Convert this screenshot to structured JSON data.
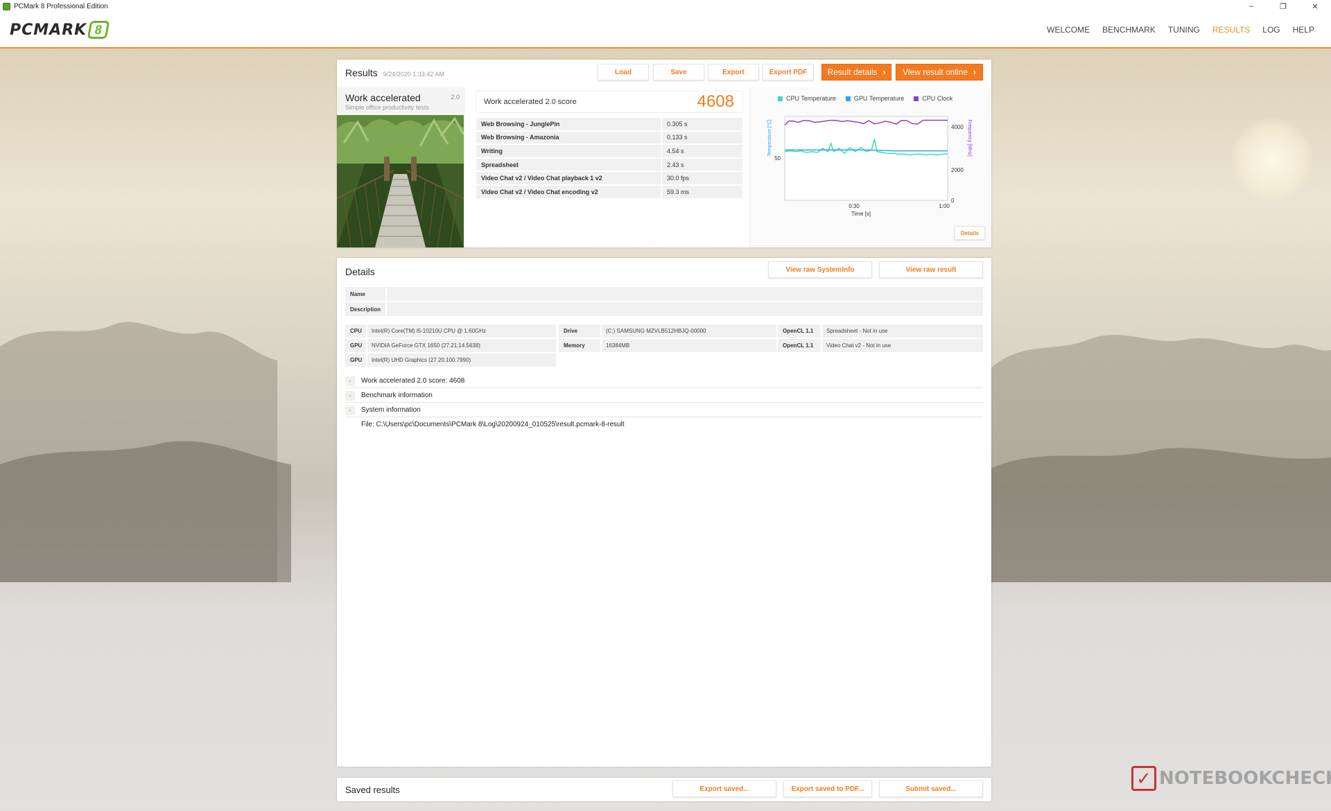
{
  "window": {
    "title": "PCMark 8 Professional Edition",
    "minimize": "–",
    "maximize": "❐",
    "close": "✕"
  },
  "header": {
    "logo_text": "PCMARK",
    "logo_badge": "8",
    "nav": [
      "WELCOME",
      "BENCHMARK",
      "TUNING",
      "RESULTS",
      "LOG",
      "HELP"
    ],
    "active_nav": "RESULTS"
  },
  "results": {
    "title": "Results",
    "date": "9/24/2020 1:33:42 AM",
    "buttons": {
      "load": "Load",
      "save": "Save",
      "export": "Export",
      "export_pdf": "Export PDF",
      "result_details": "Result details",
      "view_online": "View result online",
      "chevron": "›"
    },
    "test": {
      "name": "Work accelerated",
      "version": "2.0",
      "subtitle": "Simple office productivity tests"
    },
    "score_label": "Work accelerated 2.0 score",
    "score_value": "4608",
    "subtests": [
      {
        "name": "Web Browsing - JunglePin",
        "value": "0.305 s"
      },
      {
        "name": "Web Browsing - Amazonia",
        "value": "0.133 s"
      },
      {
        "name": "Writing",
        "value": "4.54 s"
      },
      {
        "name": "Spreadsheet",
        "value": "2.43 s"
      },
      {
        "name": "Video Chat v2 / Video Chat playback 1 v2",
        "value": "30.0 fps"
      },
      {
        "name": "Video Chat v2 / Video Chat encoding v2",
        "value": "59.3 ms"
      }
    ],
    "chart_details_button": "Details"
  },
  "chart_data": {
    "type": "line",
    "legend": [
      {
        "name": "CPU Temperature",
        "color": "#3ddbb5"
      },
      {
        "name": "GPU Temperature",
        "color": "#29a9e8"
      },
      {
        "name": "CPU Clock",
        "color": "#8b3fc9"
      }
    ],
    "xlabel": "Time [s]",
    "ylabel_left": "Temperature [°C]",
    "ylabel_right": "Frequency [MHz]",
    "x_ticks": [
      "0:30",
      "1:00"
    ],
    "y_left_ticks": [
      "50"
    ],
    "y_right_ticks": [
      "4000",
      "2000",
      "0"
    ],
    "xlim": [
      0,
      60
    ],
    "ylim_left": [
      0,
      100
    ],
    "ylim_right": [
      0,
      4400
    ],
    "series": [
      {
        "name": "CPU Clock",
        "axis": "right",
        "color": "#8b3fc9",
        "x": [
          0,
          1.5,
          3,
          5,
          7,
          9,
          11,
          13,
          15,
          17,
          19,
          21,
          23,
          25,
          27,
          29,
          31,
          33,
          35,
          37,
          39,
          41,
          43,
          45,
          47,
          49,
          51,
          53,
          55,
          57,
          59,
          60
        ],
        "y": [
          3950,
          4160,
          4160,
          4100,
          4190,
          4180,
          4090,
          4120,
          4160,
          4200,
          4190,
          4130,
          4180,
          4140,
          4100,
          4020,
          4180,
          4010,
          4060,
          4150,
          4100,
          4000,
          4190,
          4180,
          4020,
          4010,
          4200,
          4200,
          4200,
          4200,
          4200,
          4200
        ]
      },
      {
        "name": "CPU Temperature",
        "axis": "left",
        "color": "#3ddbb5",
        "x": [
          0,
          2,
          4,
          6,
          8,
          10,
          12,
          14,
          16,
          17,
          18,
          20,
          22,
          24,
          26,
          28,
          30,
          31,
          32,
          33,
          34,
          36,
          38,
          40,
          42,
          44,
          46,
          48,
          50,
          52,
          54,
          56,
          58,
          60
        ],
        "y": [
          58,
          59,
          58,
          59,
          57,
          58,
          57,
          62,
          58,
          68,
          58,
          62,
          56,
          63,
          58,
          63,
          58,
          59,
          60,
          73,
          58,
          57,
          56,
          56,
          55,
          55,
          54,
          55,
          55,
          54,
          55,
          54,
          55,
          55
        ]
      },
      {
        "name": "GPU Temperature",
        "axis": "left",
        "color": "#29a9e8",
        "x": [
          0,
          10,
          20,
          30,
          40,
          50,
          60
        ],
        "y": [
          60,
          60,
          60,
          60,
          59,
          59,
          59
        ]
      }
    ]
  },
  "details": {
    "title": "Details",
    "view_systeminfo": "View raw SystemInfo",
    "view_raw_result": "View raw result",
    "name_label": "Name",
    "description_label": "Description",
    "sys": {
      "cpu_label": "CPU",
      "cpu": "Intel(R) Core(TM) i5-10210U CPU @ 1.60GHz",
      "gpu_label": "GPU",
      "gpu1": "NVIDIA GeForce GTX 1650 (27.21.14.5638)",
      "gpu2": "Intel(R) UHD Graphics (27.20.100.7990)",
      "drive_label": "Drive",
      "drive": "(C:) SAMSUNG MZVLB512HBJQ-00000",
      "memory_label": "Memory",
      "memory": "16384MB",
      "opencl_label": "OpenCL 1.1",
      "opencl1": "Spreadsheet - Not in use",
      "opencl2": "Video Chat v2 - Not in use"
    },
    "expand_arrow": "›",
    "sections": [
      "Work accelerated 2.0 score: 4608",
      "Benchmark information",
      "System information"
    ],
    "file": "File: C:\\Users\\pc\\Documents\\PCMark 8\\Log\\20200924_010525\\result.pcmark-8-result"
  },
  "saved": {
    "title": "Saved results",
    "export_saved": "Export saved...",
    "export_saved_pdf": "Export saved to PDF...",
    "submit_saved": "Submit saved..."
  },
  "watermark": {
    "text": "NOTEBOOKCHECK",
    "mark": "✓"
  }
}
